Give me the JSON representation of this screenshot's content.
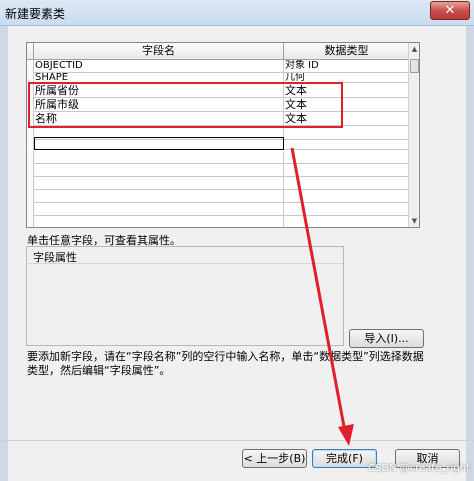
{
  "window": {
    "title": "新建要素类",
    "close_label": "✕"
  },
  "grid": {
    "headers": [
      "字段名",
      "数据类型"
    ],
    "rows": [
      {
        "name": "OBJECTID",
        "type": "对象 ID"
      },
      {
        "name": "SHAPE",
        "type": "几何"
      },
      {
        "name": "所属省份",
        "type": "文本"
      },
      {
        "name": "所属市级",
        "type": "文本"
      },
      {
        "name": "名称",
        "type": "文本"
      }
    ]
  },
  "click_hint": "单击任意字段，可查看其属性。",
  "props": {
    "title": "字段属性"
  },
  "import_label": "导入(I)...",
  "help_text_1": "要添加新字段，请在“字段名称”列的空行中输入名称，单击“数据类型”列选择数据",
  "help_text_2": "类型，然后编辑“字段属性”。",
  "buttons": {
    "prev": "< 上一步(B)",
    "finish": "完成(F)",
    "cancel": "取消"
  },
  "watermark": "CSDN @create_right",
  "colors": {
    "highlight": "#e01f2a"
  }
}
